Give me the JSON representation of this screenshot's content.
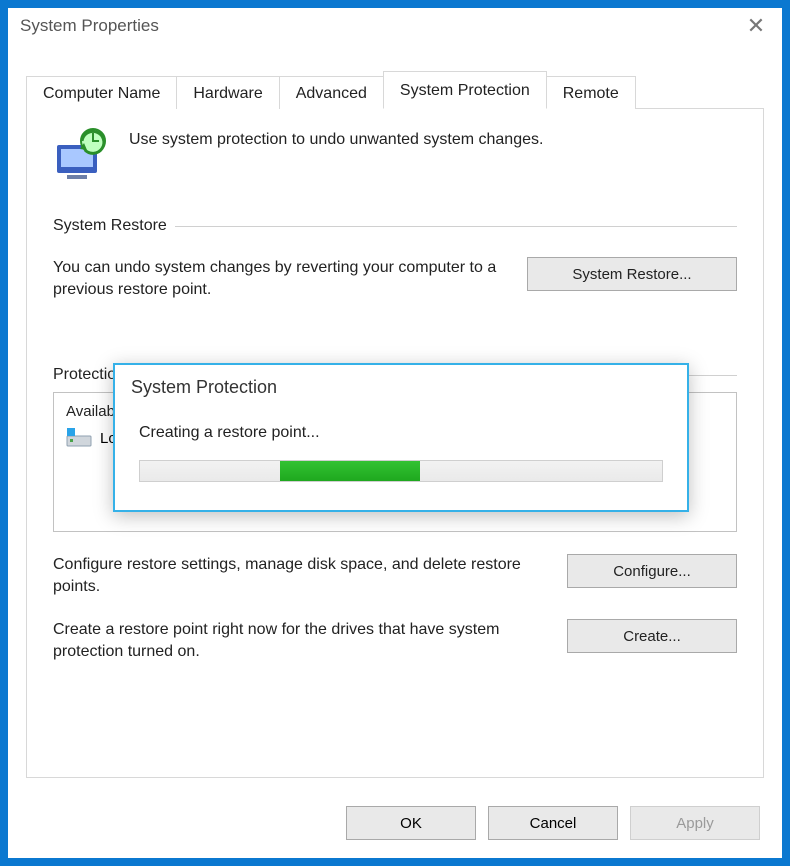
{
  "window": {
    "title": "System Properties"
  },
  "tabs": [
    {
      "label": "Computer Name"
    },
    {
      "label": "Hardware"
    },
    {
      "label": "Advanced"
    },
    {
      "label": "System Protection"
    },
    {
      "label": "Remote"
    }
  ],
  "intro": {
    "text": "Use system protection to undo unwanted system changes."
  },
  "restore_group": {
    "title": "System Restore",
    "text": "You can undo system changes by reverting your computer to a previous restore point.",
    "button": "System Restore..."
  },
  "protection_group": {
    "title": "Protection Settings",
    "available_label": "Available Drives",
    "drive_row": {
      "label": "Local Disk"
    },
    "configure_text": "Configure restore settings, manage disk space, and delete restore points.",
    "configure_button": "Configure...",
    "create_text": "Create a restore point right now for the drives that have system protection turned on.",
    "create_button": "Create..."
  },
  "buttons": {
    "ok": "OK",
    "cancel": "Cancel",
    "apply": "Apply"
  },
  "modal": {
    "title": "System Protection",
    "status": "Creating a restore point..."
  }
}
